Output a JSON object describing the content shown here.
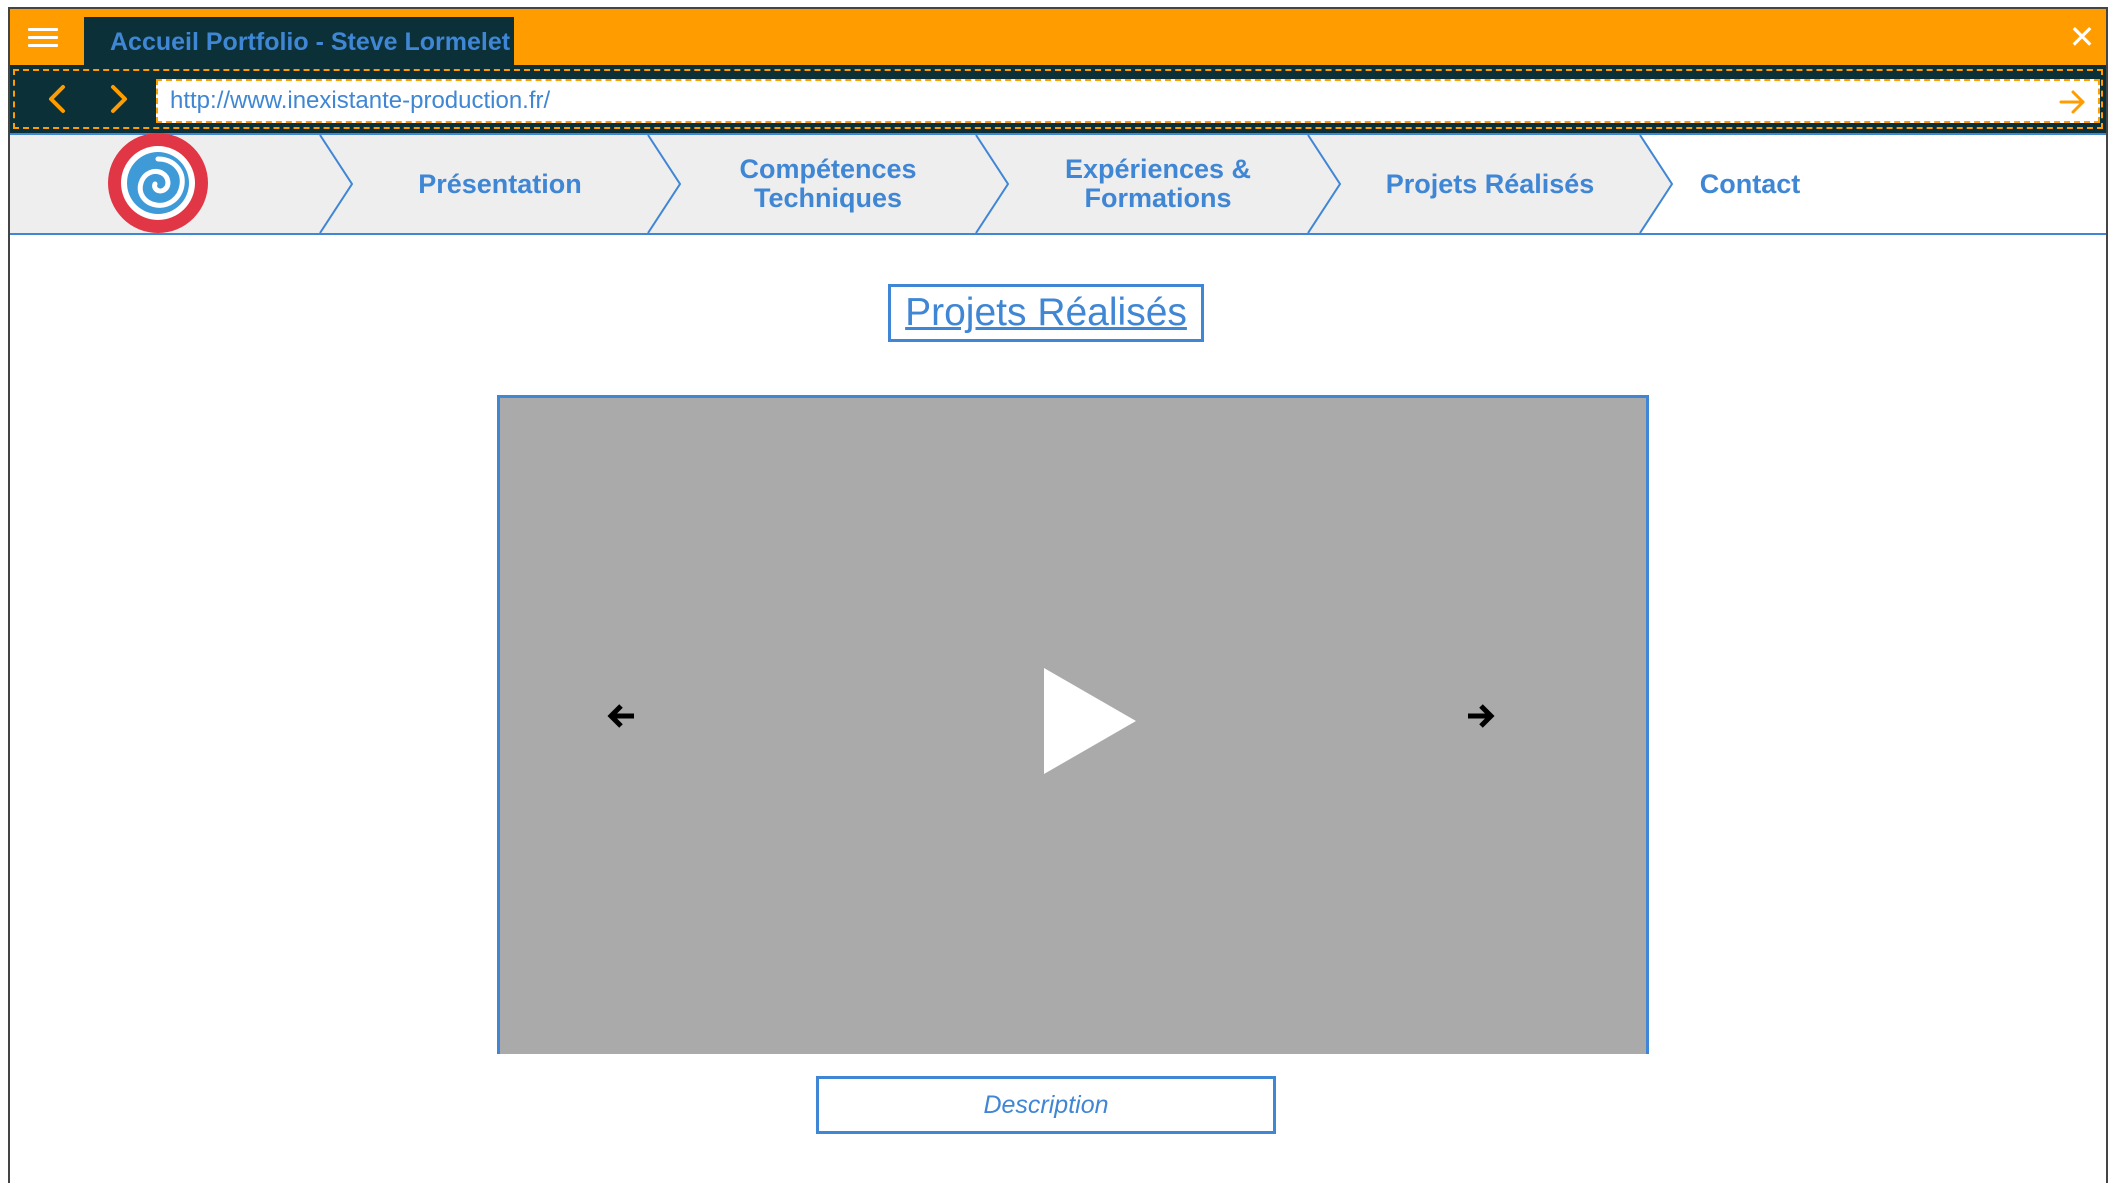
{
  "browser": {
    "tab_title": "Accueil Portfolio - Steve Lormelet",
    "url": "http://www.inexistante-production.fr/",
    "icons": {
      "menu": "hamburger-icon",
      "close": "close-icon",
      "back": "chevron-left-icon",
      "forward": "chevron-right-icon",
      "go": "arrow-right-icon"
    }
  },
  "nav": {
    "logo": "spiral-logo-icon",
    "items": [
      {
        "label": "Présentation"
      },
      {
        "label": "Compétences\nTechniques"
      },
      {
        "label": "Expériences &\nFormations"
      },
      {
        "label": "Projets Réalisés"
      },
      {
        "label": "Contact"
      }
    ]
  },
  "main": {
    "title": "Projets Réalisés",
    "carousel": {
      "play_icon": "play-icon",
      "prev_icon": "arrow-left-icon",
      "next_icon": "arrow-right-icon"
    },
    "description": "Description"
  },
  "colors": {
    "titlebar": "#ff9c00",
    "dark": "#0b3037",
    "accent_blue": "#3f86d4",
    "nav_bg": "#eeeeee",
    "video_bg": "#aaaaaa",
    "logo_red": "#e13645"
  }
}
